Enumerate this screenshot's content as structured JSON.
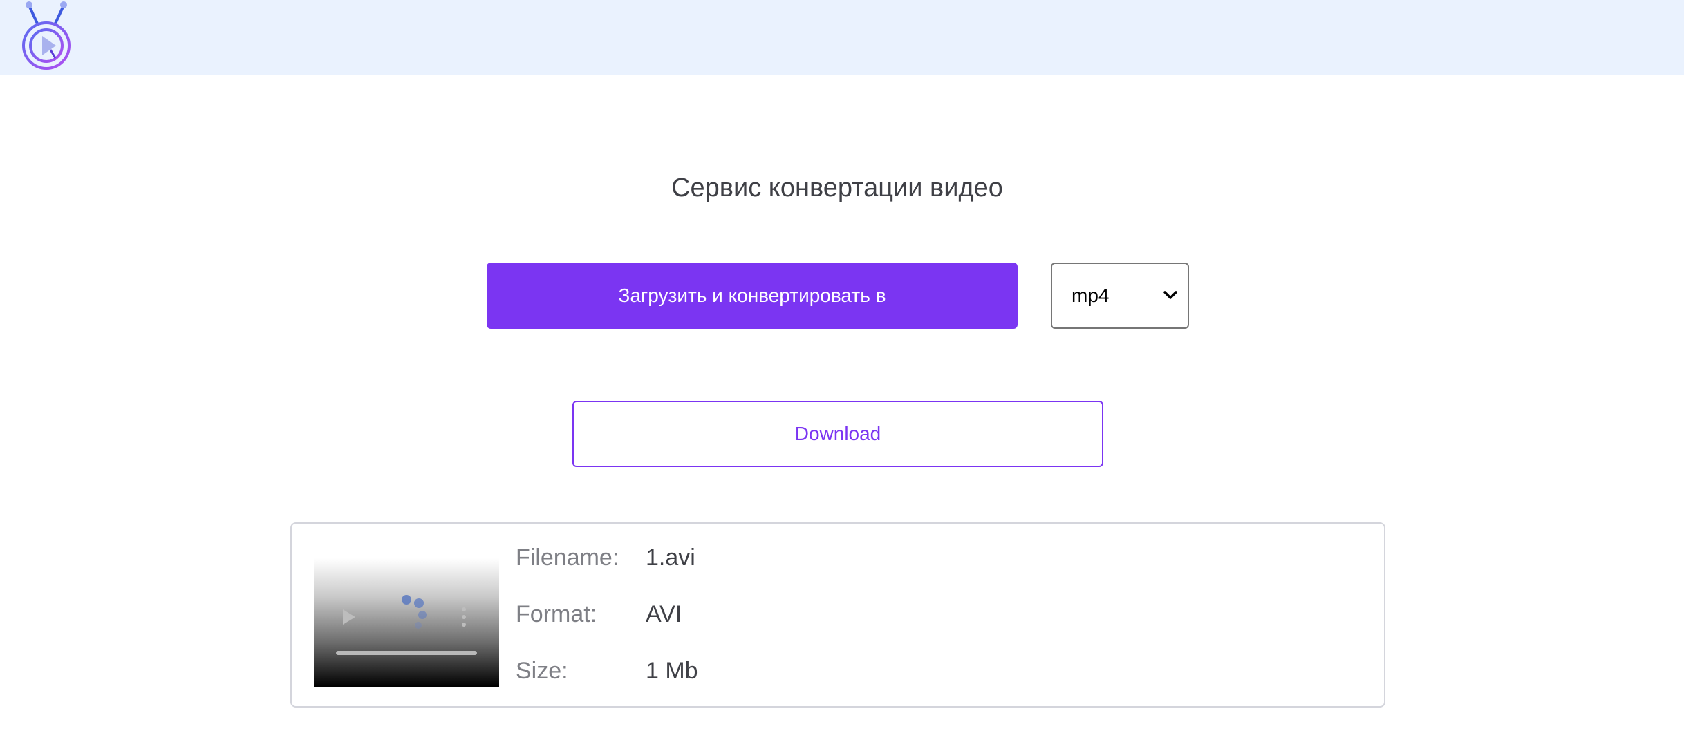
{
  "header": {
    "logo": "tv-play-logo"
  },
  "main": {
    "title": "Сервис конвертации видео",
    "convert_button_label": "Загрузить и конвертировать в",
    "format_select": {
      "selected": "mp4"
    },
    "download_button_label": "Download"
  },
  "file_info": {
    "thumbnail": "video-player-thumbnail",
    "rows": [
      {
        "label": "Filename:",
        "value": "1.avi"
      },
      {
        "label": "Format:",
        "value": "AVI"
      },
      {
        "label": "Size:",
        "value": "1 Mb"
      }
    ]
  },
  "colors": {
    "accent": "#7b35f2",
    "header_bg": "#eaf2fe",
    "text": "#3f4046",
    "label_text": "#7e7f85"
  }
}
